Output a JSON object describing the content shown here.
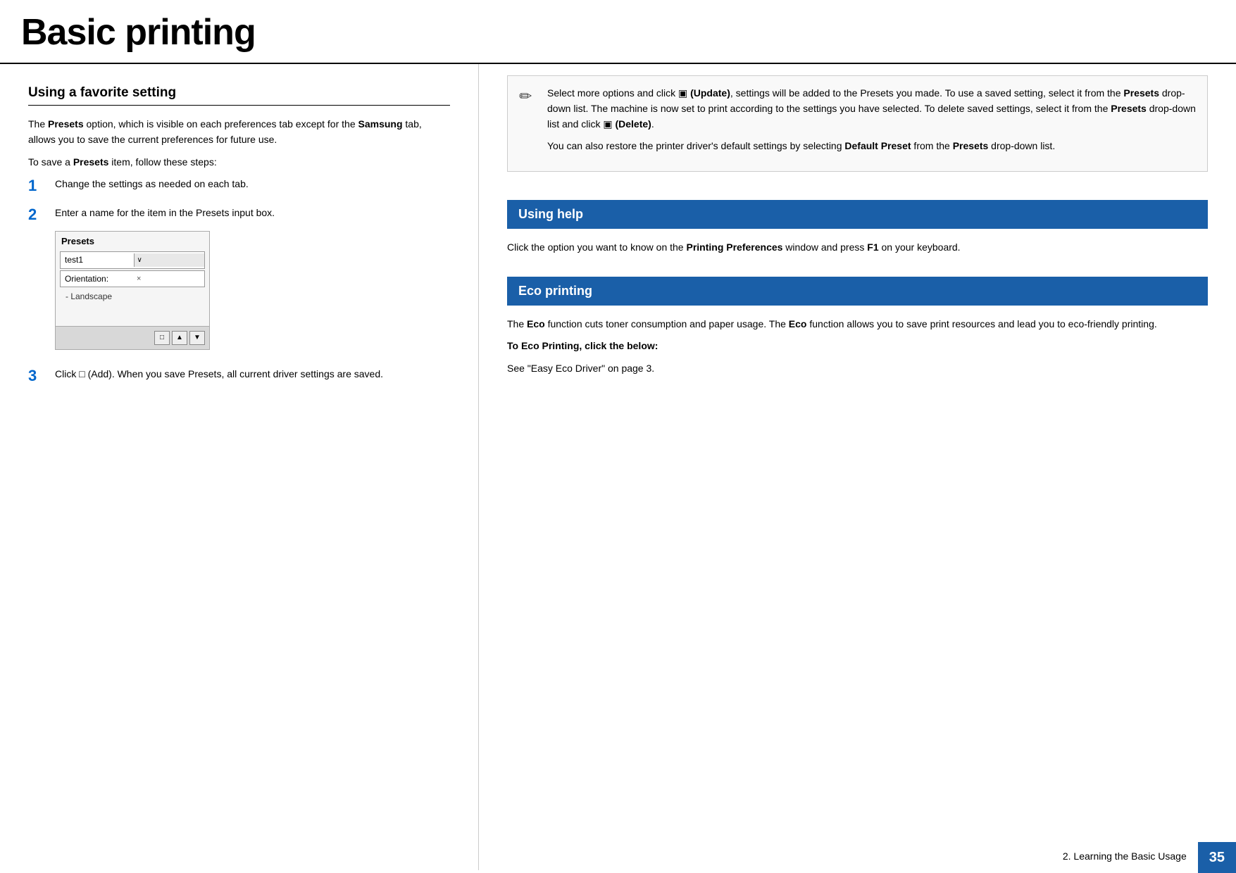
{
  "header": {
    "title": "Basic printing"
  },
  "left": {
    "section_heading": "Using a favorite setting",
    "intro1_normal1": "The ",
    "intro1_bold1": "Presets",
    "intro1_normal2": " option, which is visible on each preferences tab except for the ",
    "intro1_bold2": "Samsung",
    "intro1_normal3": " tab, allows you to save the current preferences for future use.",
    "intro2_normal1": "To save a ",
    "intro2_bold1": "Presets",
    "intro2_normal2": " item, follow these steps:",
    "steps": [
      {
        "num": "1",
        "text_normal": "Change the settings as needed on each tab."
      },
      {
        "num": "2",
        "text_normal1": "Enter a name for the item in the ",
        "text_bold": "Presets",
        "text_normal2": " input box."
      },
      {
        "num": "3",
        "text_normal1": "Click ",
        "text_icon": "□",
        "text_bold": "(Add)",
        "text_normal2": ". When you save ",
        "text_bold2": "Presets",
        "text_normal3": ", all current driver settings are saved."
      }
    ],
    "presets_box": {
      "label": "Presets",
      "input_value": "test1",
      "dropdown_arrow": "∨",
      "field_label": "Orientation:",
      "field_value": "- Landscape",
      "close_x": "×",
      "btn1": "□",
      "btn2": "▲",
      "btn3": "▼"
    }
  },
  "right": {
    "note": {
      "icon": "✏",
      "text_normal1": "Select more options and click ",
      "text_icon1": "▣",
      "text_bold1": " (Update)",
      "text_normal2": ", settings will be added to the Presets you made. To use a saved setting, select it from the ",
      "text_bold2": "Presets",
      "text_normal3": " drop-down list. The machine is now set to print according to the settings you have selected. To delete saved settings, select it from the ",
      "text_bold3": "Presets",
      "text_normal4": " drop-down list and click ",
      "text_icon2": "▣",
      "text_bold4": " (Delete)",
      "text_normal5": ".",
      "text2_normal1": "You can also restore the printer driver's default settings by selecting ",
      "text2_bold1": "Default Preset",
      "text2_normal2": " from the ",
      "text2_bold2": "Presets",
      "text2_normal3": " drop-down list."
    },
    "using_help": {
      "heading": "Using help",
      "text_normal1": "Click the option you want to know on the ",
      "text_bold1": "Printing Preferences",
      "text_normal2": " window and press ",
      "text_bold2": "F1",
      "text_normal3": " on your keyboard."
    },
    "eco_printing": {
      "heading": "Eco printing",
      "text_normal1": "The ",
      "text_bold1": "Eco",
      "text_normal2": " function cuts toner consumption and paper usage. The ",
      "text_bold2": "Eco",
      "text_normal3": " function allows you to save print resources and lead you to eco-friendly printing.",
      "sub_heading": "To Eco Printing, click the below:",
      "link_text": "See \"Easy Eco Driver\" on page 3."
    }
  },
  "footer": {
    "text": "2. Learning the Basic Usage",
    "page_num": "35"
  }
}
